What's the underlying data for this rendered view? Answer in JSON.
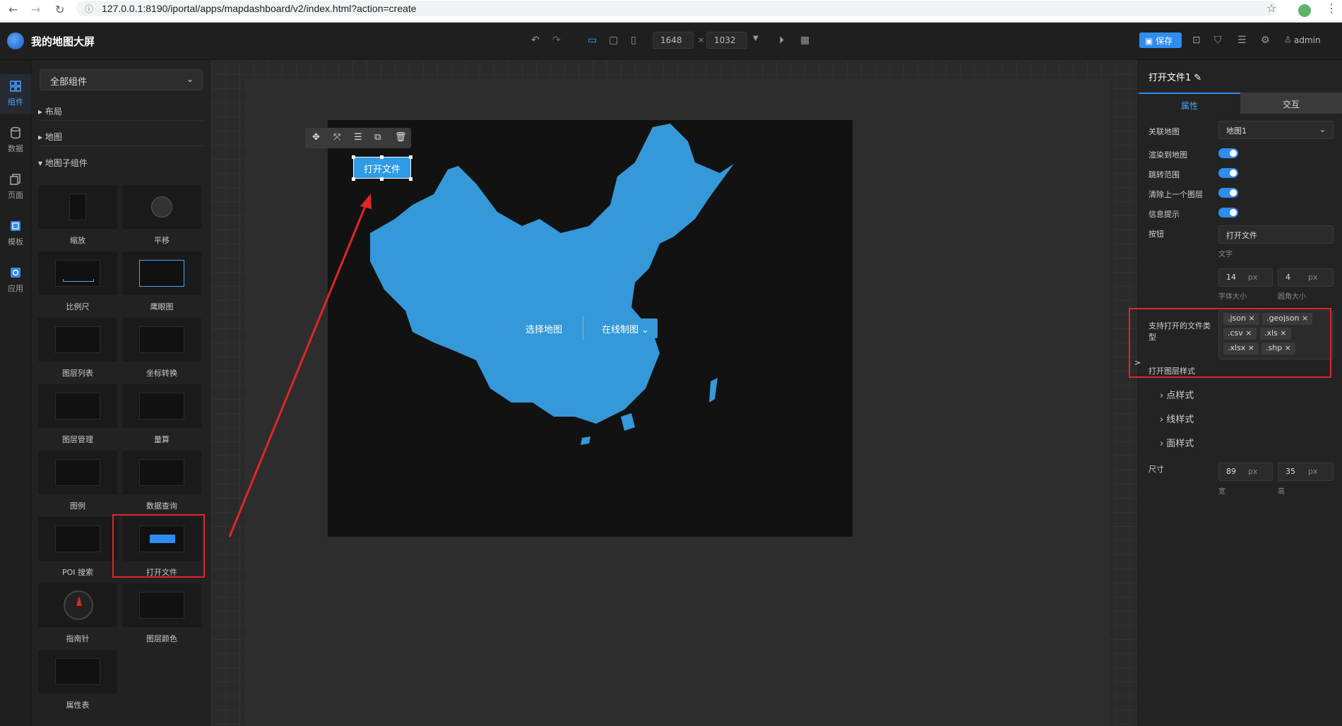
{
  "browser": {
    "url": "127.0.0.1:8190/iportal/apps/mapdashboard/v2/index.html?action=create"
  },
  "header": {
    "title": "我的地图大屏",
    "width": "1648",
    "height": "1032",
    "times": "×",
    "save_label": "保存",
    "user": "admin"
  },
  "rail": [
    {
      "label": "组件",
      "icon": "grid-icon"
    },
    {
      "label": "数据",
      "icon": "database-icon"
    },
    {
      "label": "页面",
      "icon": "page-icon"
    },
    {
      "label": "模板",
      "icon": "template-icon"
    },
    {
      "label": "应用",
      "icon": "app-icon"
    }
  ],
  "components": {
    "select": "全部组件",
    "categories": [
      "布局",
      "地图",
      "地图子组件"
    ],
    "tiles": [
      "缩放",
      "平移",
      "比例尺",
      "鹰眼图",
      "图层列表",
      "坐标转换",
      "图层管理",
      "量算",
      "图例",
      "数据查询",
      "POI 搜索",
      "打开文件",
      "指南针",
      "图层颜色",
      "属性表"
    ]
  },
  "canvas": {
    "open_file_button": "打开文件",
    "select_map": "选择地图",
    "online_map": "在线制图"
  },
  "props": {
    "title": "打开文件1",
    "tab_attr": "属性",
    "tab_interact": "交互",
    "link_map_label": "关联地图",
    "link_map_value": "地图1",
    "render_label": "渲染到地图",
    "jump_label": "跳转范围",
    "clear_label": "清除上一个图层",
    "info_label": "信息提示",
    "button_label": "按钮",
    "button_text": "打开文件",
    "text_sub": "文字",
    "font_size": "14",
    "radius": "4",
    "px": "px",
    "font_size_label": "字体大小",
    "radius_label": "圆角大小",
    "file_types_label": "支持打开的文件类型",
    "file_types": [
      ".json",
      ".geojson",
      ".csv",
      ".xls",
      ".xlsx",
      ".shp"
    ],
    "layer_style": "打开图层样式",
    "point_style": "点样式",
    "line_style": "线样式",
    "polygon_style": "面样式",
    "size_label": "尺寸",
    "size_w": "89",
    "size_h": "35",
    "w_label": "宽",
    "h_label": "高"
  }
}
